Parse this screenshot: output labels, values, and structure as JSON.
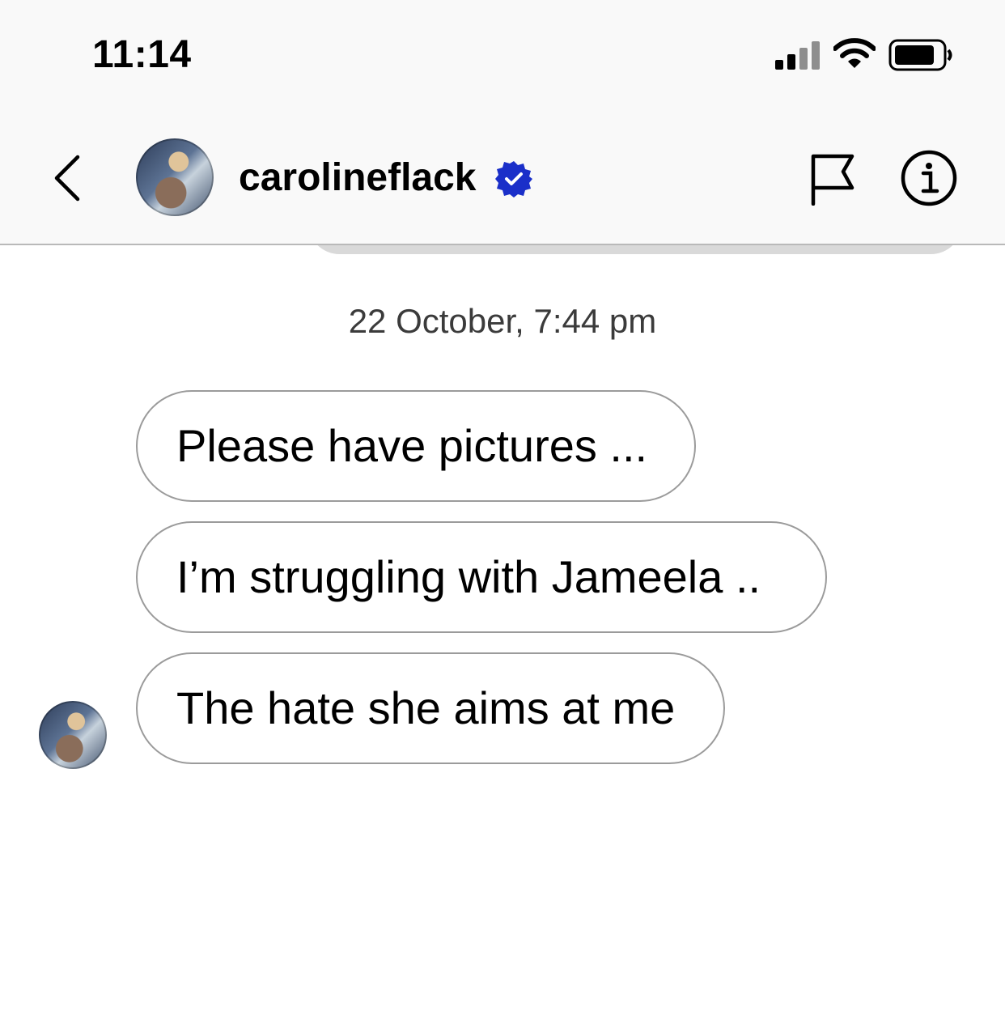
{
  "status_bar": {
    "time": "11:14",
    "signal_icon": "cellular-signal-icon",
    "wifi_icon": "wifi-icon",
    "battery_icon": "battery-icon"
  },
  "header": {
    "back_icon": "chevron-left-icon",
    "username": "carolineflack",
    "verified_icon": "verified-badge-icon",
    "verified_color": "#1a2fc9",
    "flag_icon": "flag-icon",
    "info_icon": "info-icon"
  },
  "conversation": {
    "timestamp": "22 October, 7:44 pm",
    "messages": [
      {
        "text": "Please have pictures ..."
      },
      {
        "text": "I’m struggling with Jameela .."
      },
      {
        "text": "The hate she aims at me"
      }
    ]
  }
}
